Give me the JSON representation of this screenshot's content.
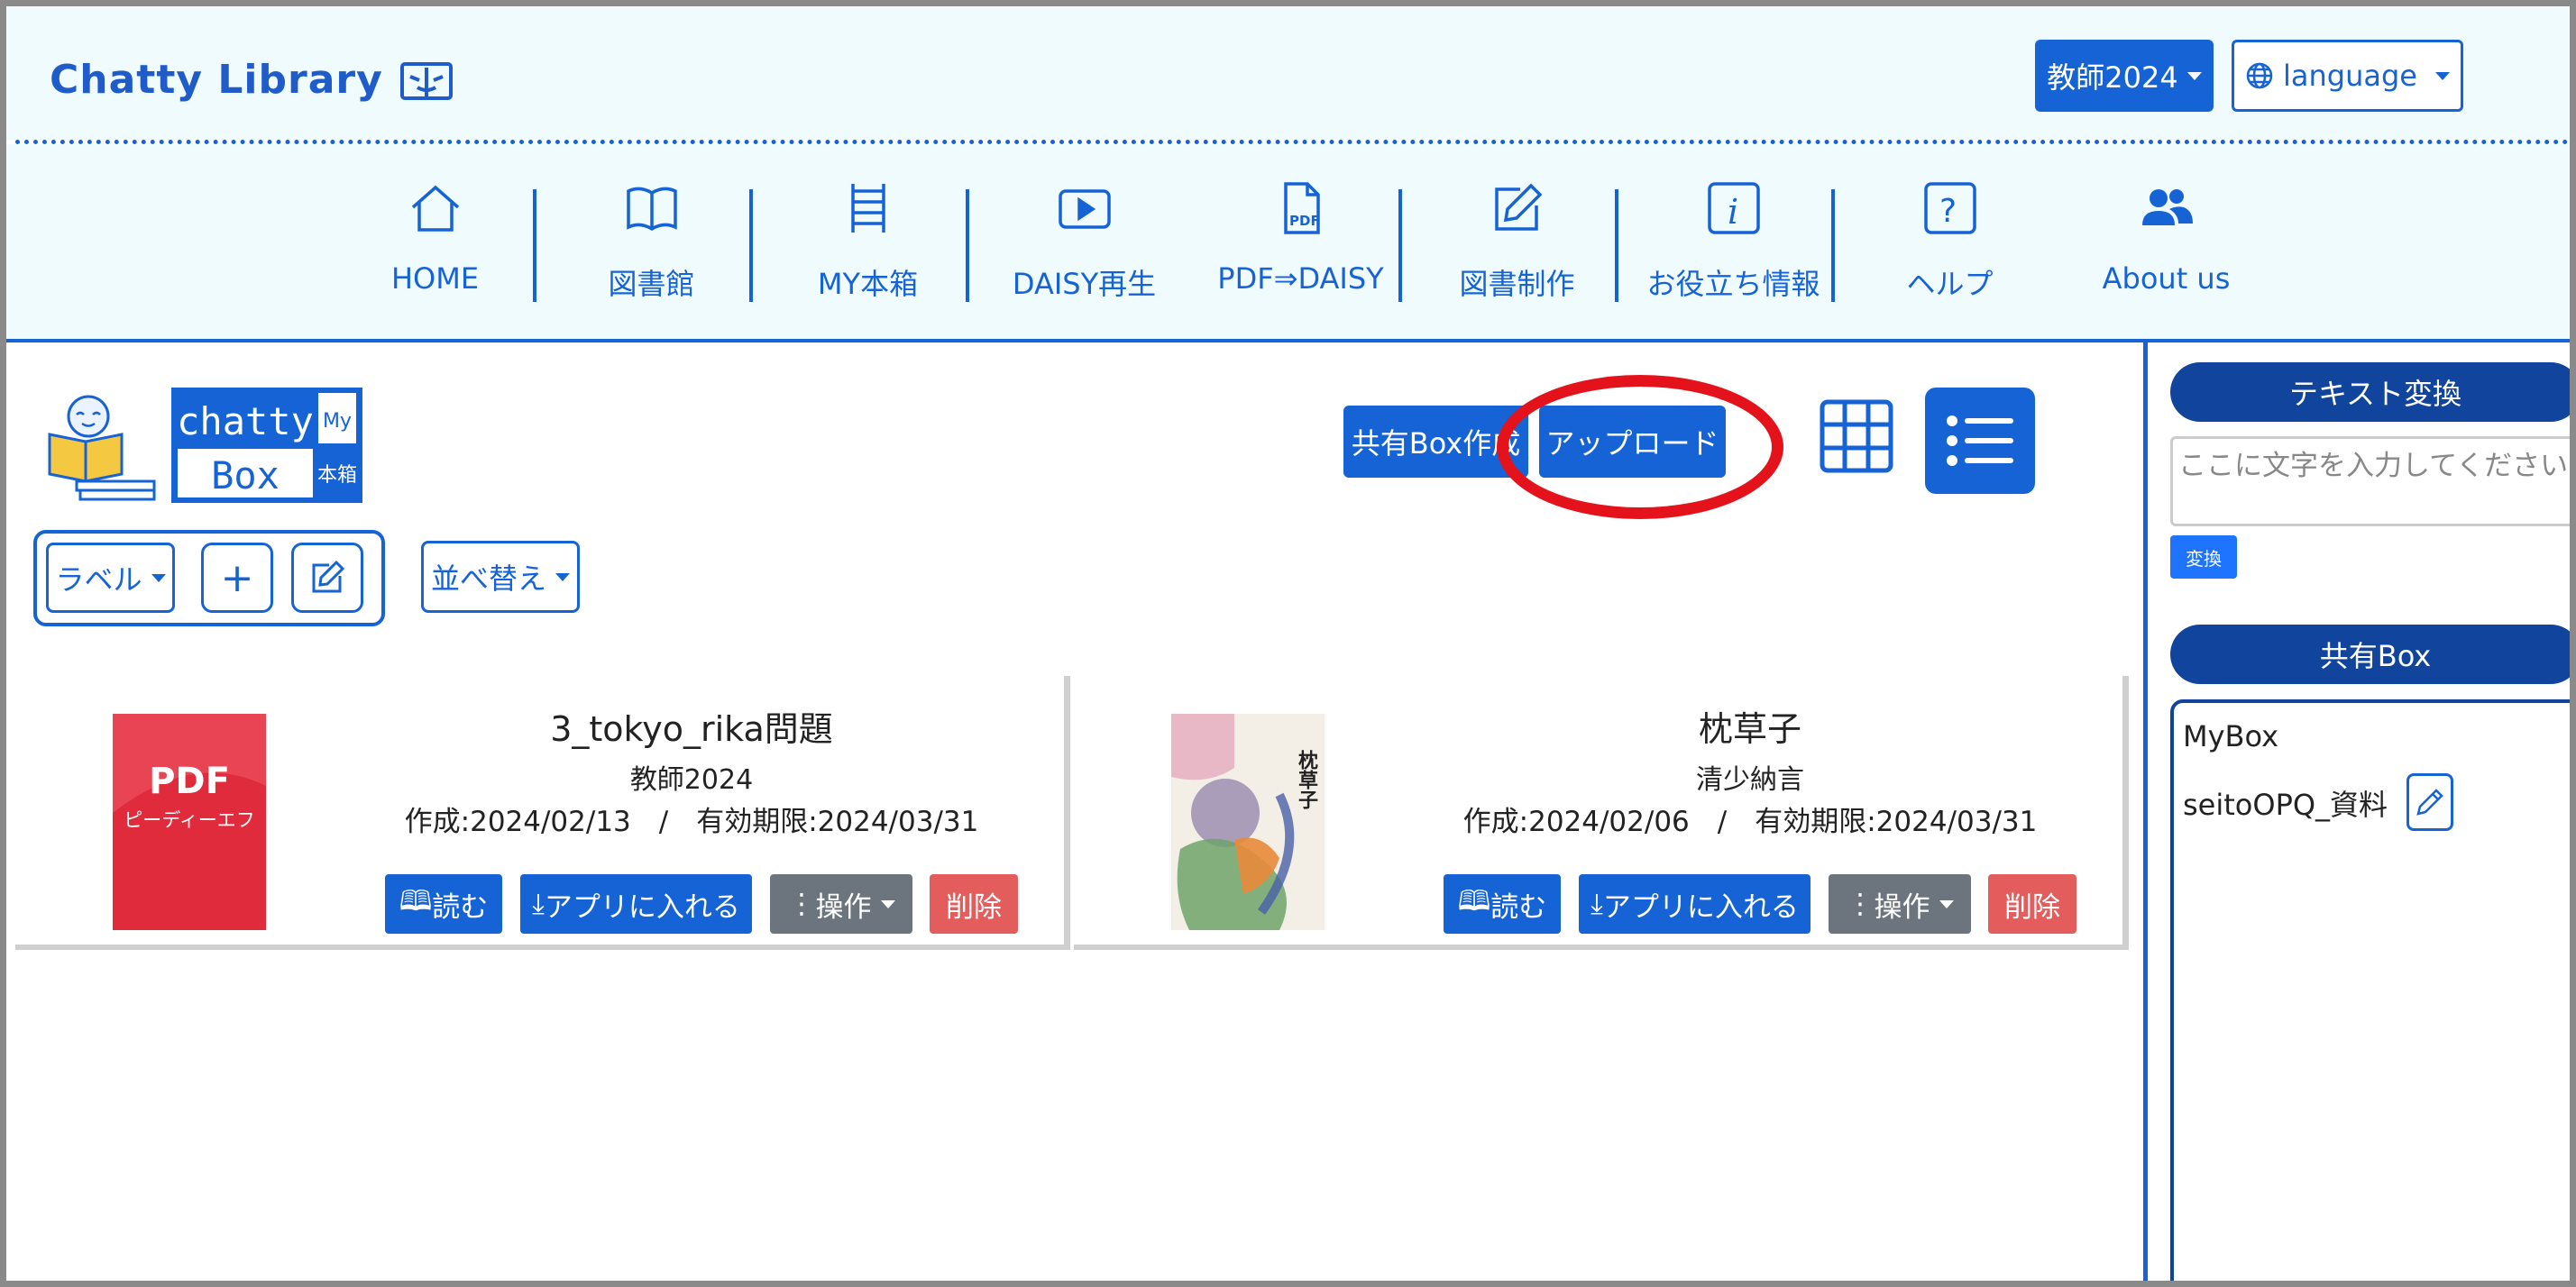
{
  "brand": {
    "title": "Chatty Library",
    "icon": "open-book-icon"
  },
  "header": {
    "user_label": "教師2024",
    "language_label": "language"
  },
  "nav": [
    {
      "label": "HOME",
      "icon": "home-icon"
    },
    {
      "label": "図書館",
      "icon": "book-icon"
    },
    {
      "label": "MY本箱",
      "icon": "bookshelf-icon"
    },
    {
      "label": "DAISY再生",
      "icon": "play-icon"
    },
    {
      "label": "PDF⇒DAISY",
      "icon": "pdf-file-icon"
    },
    {
      "label": "図書制作",
      "icon": "edit-icon"
    },
    {
      "label": "お役立ち情報",
      "icon": "info-icon"
    },
    {
      "label": "ヘルプ",
      "icon": "help-icon"
    },
    {
      "label": "About us",
      "icon": "people-icon"
    }
  ],
  "toolbar": {
    "logo_text_top": "chatty",
    "logo_text_bottom": "Box",
    "logo_side_top": "My",
    "logo_side_bottom": "本箱",
    "share_create_label": "共有Box作成",
    "upload_label": "アップロード",
    "label_dropdown": "ラベル",
    "add_label": "+",
    "sort_label": "並べ替え"
  },
  "books": [
    {
      "title": "3_tokyo_rika問題",
      "author": "教師2024",
      "dates": "作成:2024/02/13　/　有効期限:2024/03/31",
      "thumb_main": "PDF",
      "thumb_sub": "ピーディーエフ",
      "read": "読む",
      "add_app": "アプリに入れる",
      "ops": "操作",
      "delete": "削除"
    },
    {
      "title": "枕草子",
      "author": "清少納言",
      "dates": "作成:2024/02/06　/　有効期限:2024/03/31",
      "thumb_main": "枕草子",
      "read": "読む",
      "add_app": "アプリに入れる",
      "ops": "操作",
      "delete": "削除"
    }
  ],
  "sidebar": {
    "convert_title": "テキスト変換",
    "input_placeholder": "ここに文字を入力してください",
    "convert_button": "変換",
    "sharebox_title": "共有Box",
    "sharebox_items": [
      "MyBox",
      "seitoOPQ_資料"
    ]
  },
  "colors": {
    "primary": "#1663d6",
    "dark_primary": "#11449c",
    "highlight": "#e4131b",
    "danger": "#e35d5d",
    "secondary": "#6c757d"
  }
}
